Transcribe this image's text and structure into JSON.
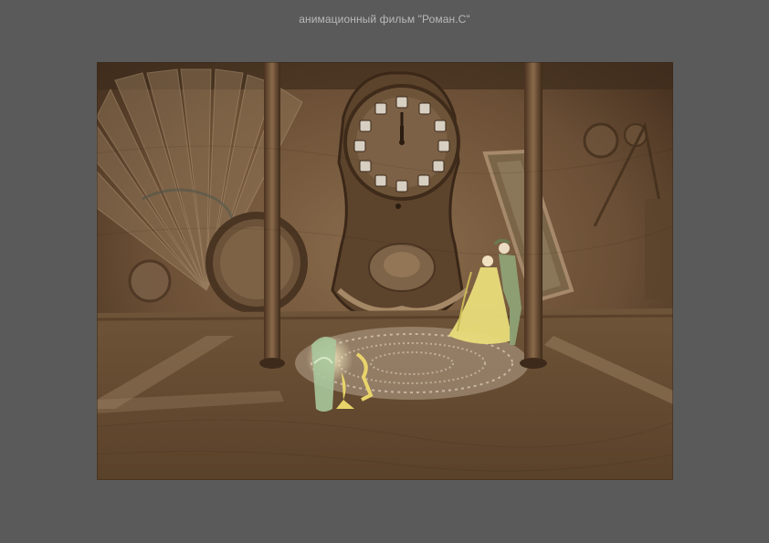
{
  "page": {
    "caption": "анимационный фильм \"Роман.С\"",
    "background_color": "#5a5a5a",
    "caption_color": "#b9b9b9"
  },
  "artwork": {
    "subject": "animation-still",
    "palette": {
      "sepia_dark": "#3a2818",
      "sepia_mid": "#6e5238",
      "sepia_light": "#a88a66",
      "dress_yellow": "#e8dc7a",
      "glass_green": "#a9c79b"
    },
    "icons": [
      "fan-icon",
      "mantel-clock-icon",
      "column-icon",
      "mirror-icon",
      "dancing-couple-icon",
      "glass-icon",
      "doily-icon",
      "magnifier-icon"
    ]
  }
}
